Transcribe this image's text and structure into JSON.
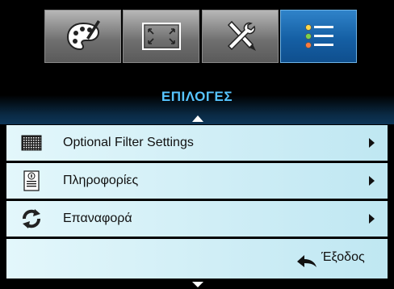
{
  "tabs": [
    {
      "icon": "palette-icon"
    },
    {
      "icon": "screen-resize-icon"
    },
    {
      "icon": "tools-icon"
    },
    {
      "icon": "options-list-icon"
    }
  ],
  "header": {
    "title": "ΕΠΙΛΟΓΕΣ"
  },
  "menu": {
    "items": [
      {
        "label": "Optional Filter Settings",
        "icon": "filter-icon"
      },
      {
        "label": "Πληροφορίες",
        "icon": "info-document-icon"
      },
      {
        "label": "Επαναφορά",
        "icon": "reset-arrows-icon"
      }
    ],
    "exit_label": "Έξοδος"
  },
  "colors": {
    "accent": "#57c5ff",
    "active_tab": "#1f6fb5",
    "row_background": "#d0eef6"
  }
}
